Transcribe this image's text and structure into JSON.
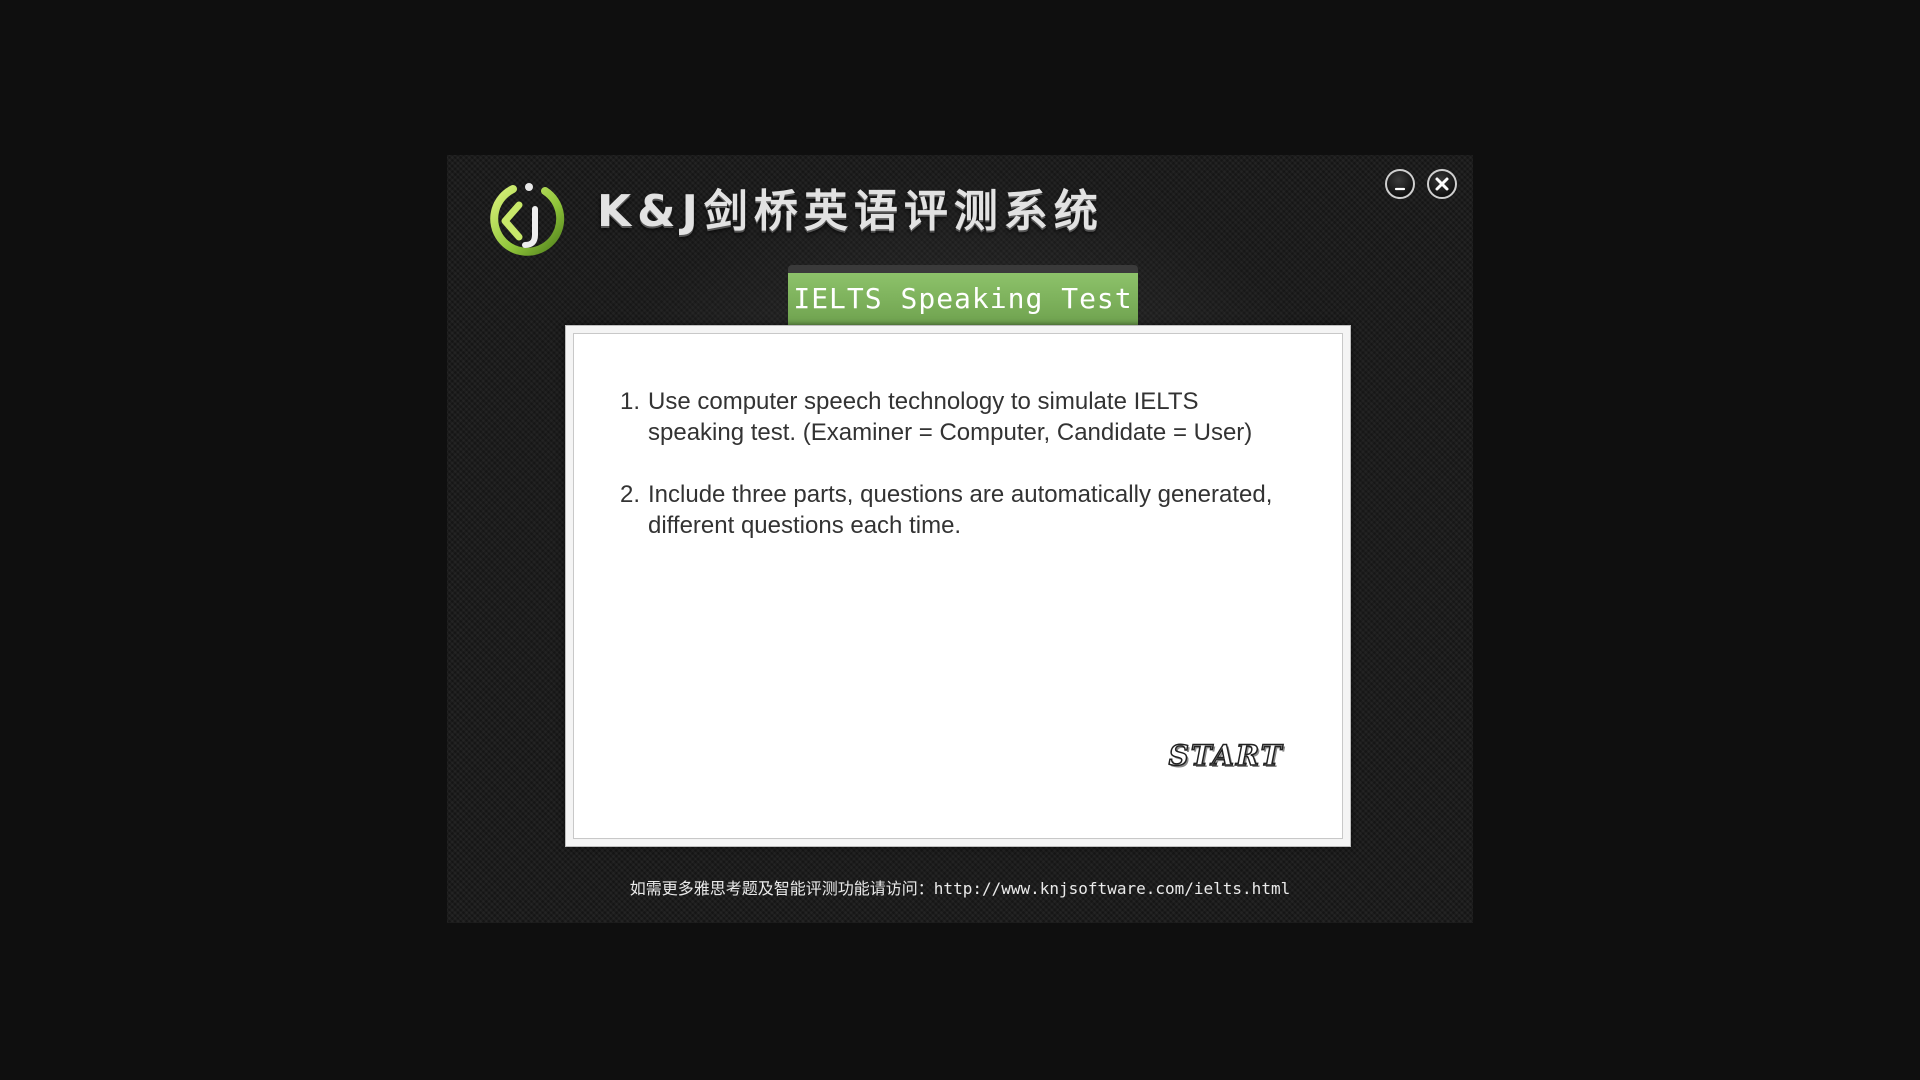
{
  "app": {
    "title": "K&J剑桥英语评测系统"
  },
  "window_controls": {
    "minimize_icon": "minimize-icon",
    "close_icon": "close-icon"
  },
  "panel": {
    "tab_title": "IELTS Speaking Test",
    "items": [
      {
        "number": "1.",
        "text": "Use computer speech technology to simulate IELTS speaking test.   (Examiner = Computer, Candidate = User)"
      },
      {
        "number": "2.",
        "text": "Include three parts, questions are automatically generated, different questions each time."
      }
    ],
    "start_label": "START"
  },
  "footer": {
    "prefix": "如需更多雅思考题及智能评测功能请访问：",
    "url": "http://www.knjsoftware.com/ielts.html"
  },
  "colors": {
    "accent_green": "#7db35c",
    "background": "#0f0f0f"
  }
}
